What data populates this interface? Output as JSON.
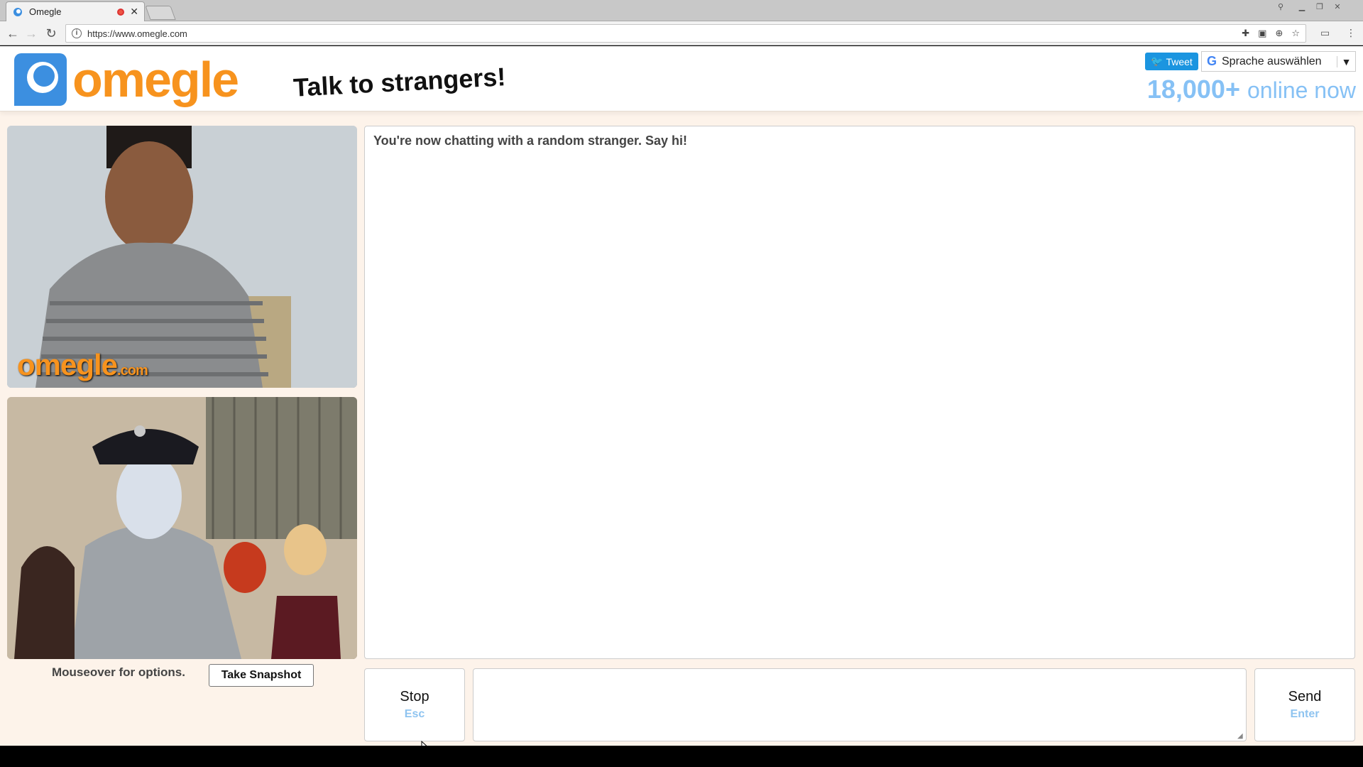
{
  "browser": {
    "tab_title": "Omegle",
    "url": "https://www.omegle.com"
  },
  "header": {
    "logo_text": "omegle",
    "tagline": "Talk to strangers!",
    "tweet_label": "Tweet",
    "translate_label": "Sprache auswählen",
    "online_count": "18,000+",
    "online_label": "online now"
  },
  "video": {
    "watermark": "omegle",
    "watermark_suffix": ".com",
    "mouseover_text": "Mouseover for options.",
    "snapshot_label": "Take Snapshot"
  },
  "chat": {
    "status_message": "You're now chatting with a random stranger. Say hi!",
    "input_value": "",
    "stop_label": "Stop",
    "stop_shortcut": "Esc",
    "send_label": "Send",
    "send_shortcut": "Enter"
  },
  "colors": {
    "brand_orange": "#f7931e",
    "brand_blue": "#3c8fe0",
    "online_blue": "#86c1f5",
    "page_bg": "#fdf3ea"
  }
}
